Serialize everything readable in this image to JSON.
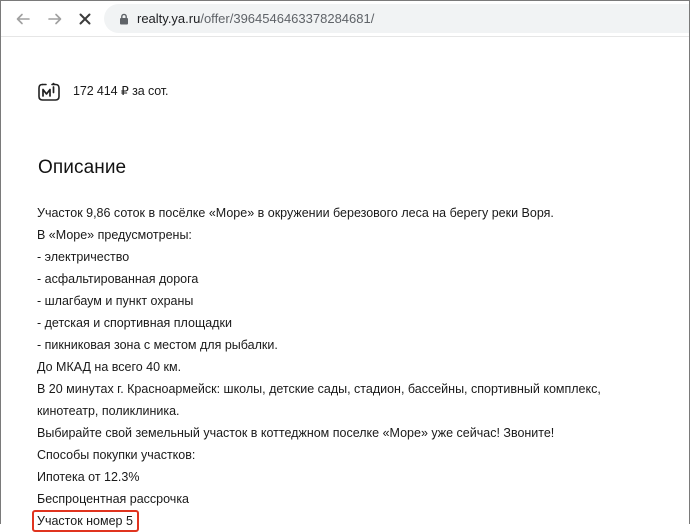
{
  "browser": {
    "url_domain": "realty.ya.ru",
    "url_path": "/offer/3964546463378284681/"
  },
  "offer": {
    "price_per_sotka": "172 414 ₽ за сот.",
    "description_heading": "Описание",
    "description_lines": [
      "Участок 9,86 соток в посёлке «Море» в окружении березового леса на берегу реки Воря.",
      "В «Море» предусмотрены:",
      "- электричество",
      "- асфальтированная дорога",
      "- шлагбаум и пункт охраны",
      "- детская и спортивная площадки",
      "- пикниковая зона с местом для рыбалки.",
      "До МКАД на всего 40 км.",
      "В 20 минутах г. Красноармейск: школы, детские сады, стадион, бассейны, спортивный комплекс,",
      "кинотеатр, поликлиника.",
      "Выбирайте свой земельный участок в коттеджном поселке «Море» уже сейчас! Звоните!",
      "Способы покупки участков:",
      "Ипотека от 12.3%",
      "Беспроцентная рассрочка"
    ],
    "highlighted_line": "Участок номер 5"
  },
  "colors": {
    "highlight_border": "#e0341f",
    "omnibox_bg": "#f1f3f4"
  },
  "icons": {
    "back": "arrow-left-icon",
    "forward": "arrow-right-icon",
    "stop": "close-icon",
    "lock": "lock-icon",
    "metro": "metro-icon"
  }
}
